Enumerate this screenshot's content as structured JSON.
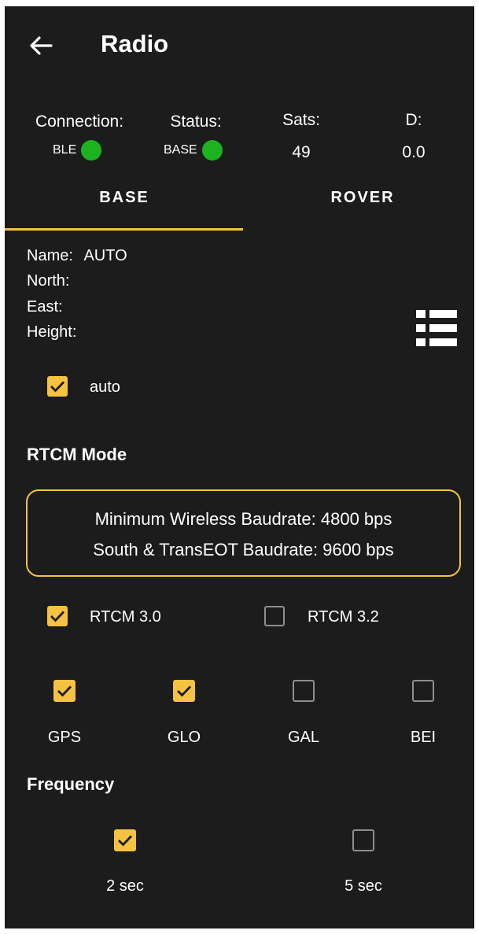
{
  "header": {
    "title": "Radio"
  },
  "status": {
    "connection_label": "Connection:",
    "connection_value": "BLE",
    "status_label": "Status:",
    "status_value": "BASE",
    "sats_label": "Sats:",
    "sats_value": "49",
    "d_label": "D:",
    "d_value": "0.0",
    "indicator_color": "#1db320"
  },
  "tabs": [
    {
      "label": "BASE",
      "selected": true
    },
    {
      "label": "ROVER",
      "selected": false
    }
  ],
  "info": {
    "name_label": "Name:",
    "name_value": "AUTO",
    "north_label": "North:",
    "east_label": "East:",
    "height_label": "Height:"
  },
  "auto": {
    "label": "auto",
    "checked": true
  },
  "rtcm": {
    "heading": "RTCM Mode",
    "min_wireless": "Minimum Wireless Baudrate:  4800 bps",
    "south_transeot": "South & TransEOT Baudrate:  9600 bps",
    "options": [
      {
        "label": "RTCM 3.0",
        "checked": true
      },
      {
        "label": "RTCM 3.2",
        "checked": false
      }
    ]
  },
  "gnss": [
    {
      "label": "GPS",
      "checked": true
    },
    {
      "label": "GLO",
      "checked": true
    },
    {
      "label": "GAL",
      "checked": false
    },
    {
      "label": "BEI",
      "checked": false
    }
  ],
  "frequency": {
    "heading": "Frequency",
    "options": [
      {
        "label": "2 sec",
        "checked": true
      },
      {
        "label": "5 sec",
        "checked": false
      }
    ]
  },
  "colors": {
    "accent": "#f5c242",
    "background": "#1c1c1c"
  }
}
